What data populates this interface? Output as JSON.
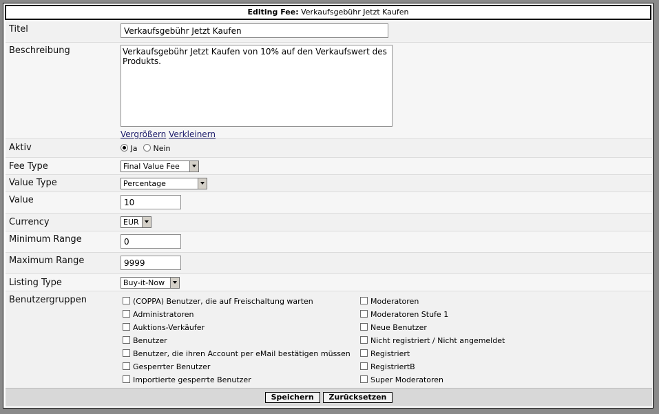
{
  "header": {
    "prefix": "Editing Fee:",
    "title": "Verkaufsgebühr Jetzt Kaufen"
  },
  "fields": {
    "titel": {
      "label": "Titel",
      "value": "Verkaufsgebühr Jetzt Kaufen"
    },
    "beschreibung": {
      "label": "Beschreibung",
      "value": "Verkaufsgebühr Jetzt Kaufen von 10% auf den Verkaufswert des Produkts.",
      "enlarge": "Vergrößern",
      "shrink": "Verkleinern"
    },
    "aktiv": {
      "label": "Aktiv",
      "yes": "Ja",
      "no": "Nein",
      "selected": "Ja"
    },
    "fee_type": {
      "label": "Fee Type",
      "value": "Final Value Fee"
    },
    "value_type": {
      "label": "Value Type",
      "value": "Percentage"
    },
    "value": {
      "label": "Value",
      "value": "10"
    },
    "currency": {
      "label": "Currency",
      "value": "EUR"
    },
    "min_range": {
      "label": "Minimum Range",
      "value": "0"
    },
    "max_range": {
      "label": "Maximum Range",
      "value": "9999"
    },
    "listing_type": {
      "label": "Listing Type",
      "value": "Buy-it-Now"
    },
    "usergroups": {
      "label": "Benutzergruppen",
      "left": [
        "(COPPA) Benutzer, die auf Freischaltung warten",
        "Administratoren",
        "Auktions-Verkäufer",
        "Benutzer",
        "Benutzer, die ihren Account per eMail bestätigen müssen",
        "Gesperrter Benutzer",
        "Importierte gesperrte Benutzer"
      ],
      "right": [
        "Moderatoren",
        "Moderatoren Stufe 1",
        "Neue Benutzer",
        "Nicht registriert / Nicht angemeldet",
        "Registriert",
        "RegistriertB",
        "Super Moderatoren"
      ]
    }
  },
  "buttons": {
    "save": "Speichern",
    "reset": "Zurücksetzen"
  }
}
